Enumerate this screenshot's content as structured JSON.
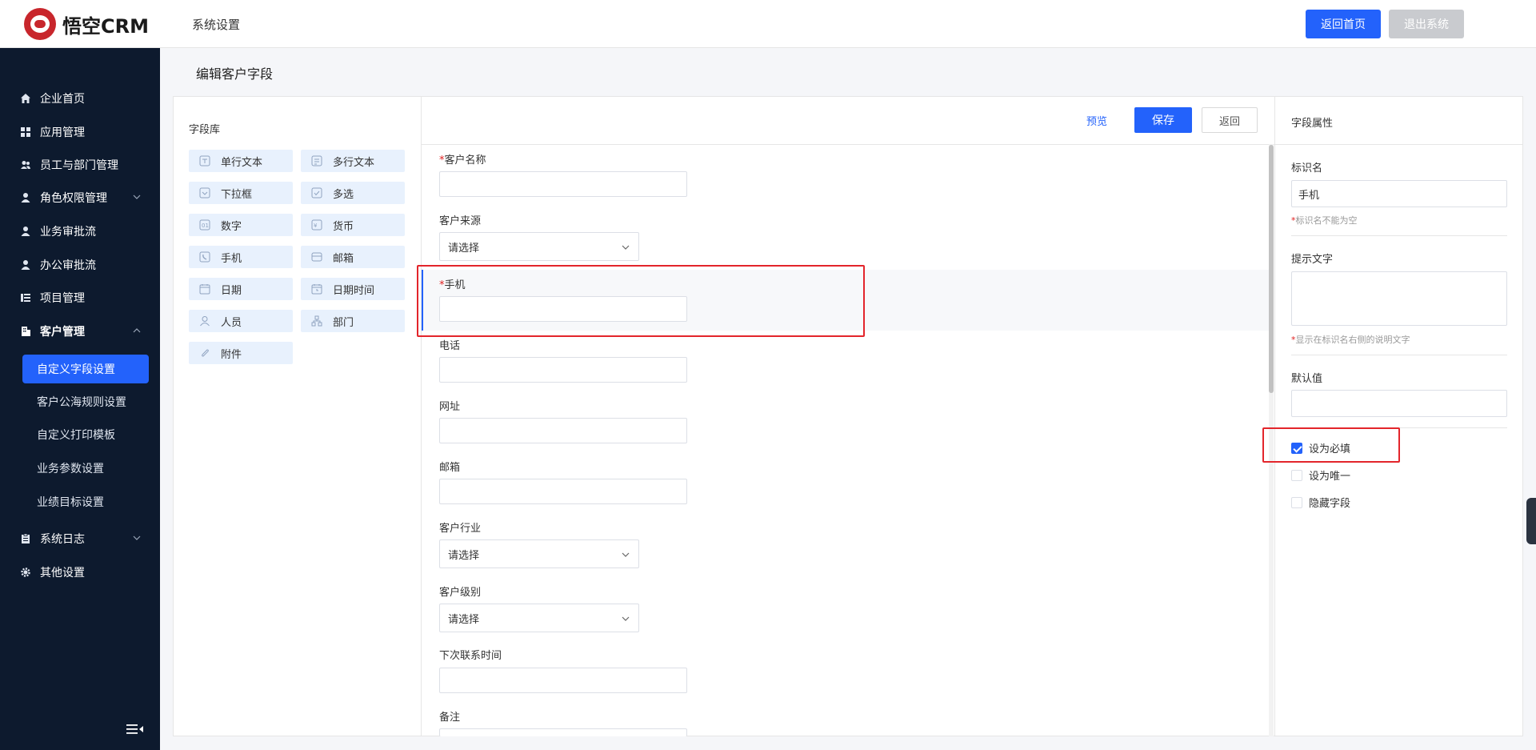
{
  "header": {
    "logo_text": "悟空CRM",
    "title": "系统设置",
    "home_button": "返回首页",
    "exit_button": "退出系统"
  },
  "sidebar": {
    "items": [
      {
        "label": "企业首页",
        "icon": "home-icon"
      },
      {
        "label": "应用管理",
        "icon": "grid-icon"
      },
      {
        "label": "员工与部门管理",
        "icon": "users-icon"
      },
      {
        "label": "角色权限管理",
        "icon": "user-icon"
      },
      {
        "label": "业务审批流",
        "icon": "user-icon"
      },
      {
        "label": "办公审批流",
        "icon": "user-icon"
      },
      {
        "label": "项目管理",
        "icon": "list-icon"
      },
      {
        "label": "客户管理",
        "icon": "building-icon"
      }
    ],
    "sub_items": [
      "自定义字段设置",
      "客户公海规则设置",
      "自定义打印模板",
      "业务参数设置",
      "业绩目标设置"
    ],
    "bottom_items": [
      {
        "label": "系统日志",
        "icon": "clipboard-icon"
      },
      {
        "label": "其他设置",
        "icon": "gear-icon"
      }
    ]
  },
  "page": {
    "title": "编辑客户字段"
  },
  "library": {
    "title": "字段库",
    "fields": [
      "单行文本",
      "多行文本",
      "下拉框",
      "多选",
      "数字",
      "货币",
      "手机",
      "邮箱",
      "日期",
      "日期时间",
      "人员",
      "部门",
      "附件"
    ]
  },
  "toolbar": {
    "preview": "预览",
    "save": "保存",
    "back": "返回"
  },
  "form": {
    "fields": [
      {
        "label": "客户名称",
        "required": true
      },
      {
        "label": "客户来源",
        "type": "select",
        "value": "请选择"
      },
      {
        "label": "手机",
        "required": true
      },
      {
        "label": "电话"
      },
      {
        "label": "网址"
      },
      {
        "label": "邮箱"
      },
      {
        "label": "客户行业",
        "type": "select",
        "value": "请选择"
      },
      {
        "label": "客户级别",
        "type": "select",
        "value": "请选择"
      },
      {
        "label": "下次联系时间"
      },
      {
        "label": "备注"
      }
    ],
    "required_mark": "*"
  },
  "properties": {
    "title": "字段属性",
    "name_label": "标识名",
    "name_value": "手机",
    "name_hint": "标识名不能为空",
    "placeholder_label": "提示文字",
    "placeholder_hint": "显示在标识名右侧的说明文字",
    "default_label": "默认值",
    "required_mark": "*",
    "options": [
      {
        "label": "设为必填",
        "checked": true
      },
      {
        "label": "设为唯一",
        "checked": false
      },
      {
        "label": "隐藏字段",
        "checked": false
      }
    ]
  },
  "colors": {
    "primary": "#2362fb",
    "sidebar_bg": "#0d1a2e",
    "highlight": "#e3252b"
  }
}
